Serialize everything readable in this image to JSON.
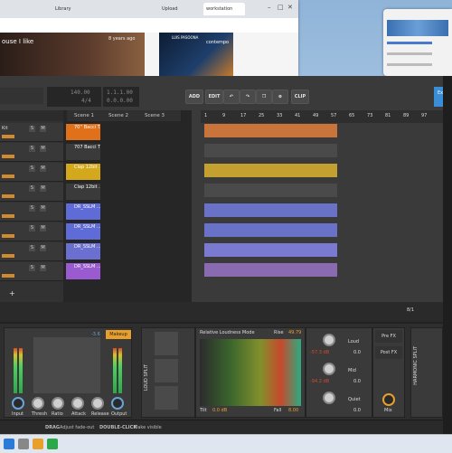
{
  "browser": {
    "tabs": [
      "",
      "",
      "Library",
      "",
      "",
      "",
      "",
      "",
      "",
      "Upload",
      "",
      "",
      "workstation",
      ""
    ],
    "video_title": "ouse I like",
    "video_meta": "8 years ago",
    "album_artist": "LUIS PASOONA",
    "album_sub": "contempo"
  },
  "toolbar": {
    "tempo": "140.00",
    "signature": "4/4",
    "position": "1.1.1.00",
    "position2": "0.0.0.00",
    "add": "ADD",
    "edit": "EDIT",
    "clip": "CLIP",
    "export": "Expo"
  },
  "scenes": [
    "Scene 1",
    "Scene 2",
    "Scene 3"
  ],
  "track_first_label": "Kit",
  "clips": [
    {
      "label": "70'' Bacci T...",
      "color": "#e0701a"
    },
    {
      "label": "707 Bacci T...",
      "color": "#3a3a3a"
    },
    {
      "label": "Clap 12bit ...",
      "color": "#d4a81c"
    },
    {
      "label": "Clap 12bit ...",
      "color": "#3a3a3a"
    },
    {
      "label": "DR_SSLM ...",
      "color": "#5f6bd6"
    },
    {
      "label": "DR_SSLM ...",
      "color": "#5f6bd6"
    },
    {
      "label": "DR_SSLM ...",
      "color": "#6b6fd0"
    },
    {
      "label": "DR_SSLM ...",
      "color": "#9a5ad0"
    }
  ],
  "ruler": [
    "1",
    "9",
    "17",
    "25",
    "33",
    "41",
    "49",
    "57",
    "65",
    "73",
    "81",
    "89",
    "97"
  ],
  "pager": "8/1",
  "device": {
    "makeup_value": "-3.6",
    "makeup_label": "Makeup",
    "knobs": [
      "Input",
      "Thresh",
      "Ratio",
      "Attack",
      "Release",
      "Output"
    ],
    "loud_split": "LOUD SPLIT",
    "rlm_title": "Relative Loudness Mode",
    "rise_label": "Rise",
    "rise_value": "49.79",
    "tilt_label": "Tilt",
    "tilt_value": "0.0 dB",
    "fall_label": "Fall",
    "fall_value": "8.00",
    "bands": [
      {
        "label": "Loud",
        "value": "-57.3 dB",
        "db": "0.0"
      },
      {
        "label": "Mid",
        "value": "-94.2 dB",
        "db": "0.0"
      },
      {
        "label": "Quiet",
        "value": "",
        "db": "0.0"
      }
    ],
    "pre_fx": "Pre FX",
    "post_fx": "Post FX",
    "mix": "Mix",
    "harmonic_split": "HARMONIC SPLIT"
  },
  "status": {
    "drag": "DRAG",
    "drag_desc": "Adjust fade-out",
    "dbl": "DOUBLE-CLICK",
    "dbl_desc": "Make visible"
  }
}
